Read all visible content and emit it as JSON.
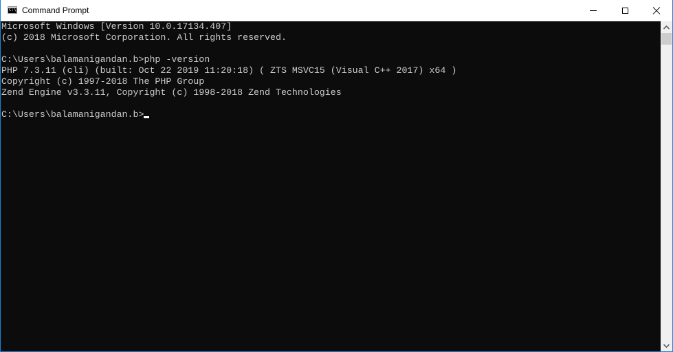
{
  "window": {
    "title": "Command Prompt",
    "icon": "cmd-icon",
    "icon_text": "C:\\_",
    "controls": {
      "minimize": "minimize-icon",
      "maximize": "maximize-icon",
      "close": "close-icon"
    }
  },
  "console": {
    "lines": [
      "Microsoft Windows [Version 10.0.17134.407]",
      "(c) 2018 Microsoft Corporation. All rights reserved.",
      "",
      "C:\\Users\\balamanigandan.b>php -version",
      "PHP 7.3.11 (cli) (built: Oct 22 2019 11:20:18) ( ZTS MSVC15 (Visual C++ 2017) x64 )",
      "Copyright (c) 1997-2018 The PHP Group",
      "Zend Engine v3.3.11, Copyright (c) 1998-2018 Zend Technologies",
      "",
      "C:\\Users\\balamanigandan.b>"
    ],
    "foreground": "#cccccc",
    "background": "#0c0c0c"
  },
  "scrollbar": {
    "up_icon": "chevron-up-icon",
    "down_icon": "chevron-down-icon",
    "position_fraction": 0.0
  },
  "colors": {
    "border": "#1883d7",
    "titlebar": "#ffffff"
  }
}
